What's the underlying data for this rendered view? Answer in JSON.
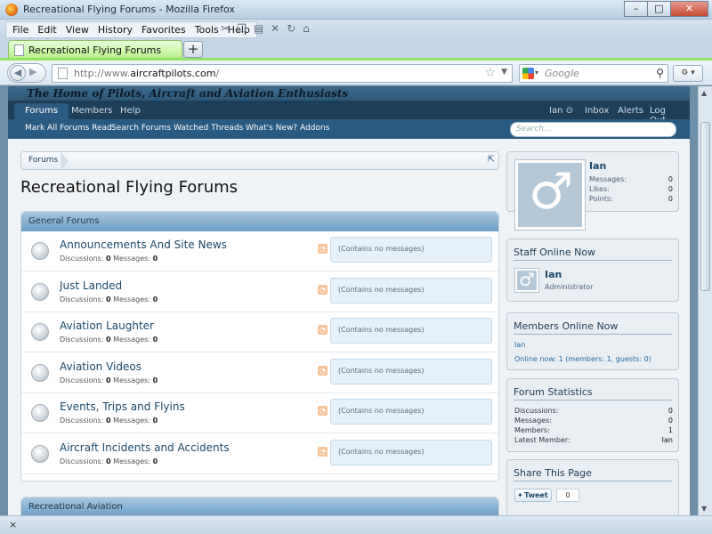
{
  "window": {
    "title": "Recreational Flying Forums - Mozilla Firefox",
    "minimize": "–",
    "maximize": "□",
    "close": "✕"
  },
  "menu": [
    "File",
    "Edit",
    "View",
    "History",
    "Favorites",
    "Tools",
    "Help"
  ],
  "tab": {
    "label": "Recreational Flying Forums",
    "new_tab": "+"
  },
  "address": {
    "prefix": "http://www.",
    "domain": "aircraftpilots.com",
    "suffix": "/"
  },
  "search": {
    "placeholder": "Google"
  },
  "site": {
    "tagline": "The Home of Pilots, Aircraft and Aviation Enthusiasts",
    "tabs": {
      "forums": "Forums",
      "members": "Members",
      "help": "Help"
    },
    "user": {
      "name": "Ian",
      "inbox": "Inbox",
      "alerts": "Alerts",
      "logout": "Log Out"
    },
    "subnav": [
      "Mark All Forums Read",
      "Search Forums",
      "Watched Threads",
      "What's New?",
      "Addons"
    ],
    "search_placeholder": "Search..."
  },
  "breadcrumb": "Forums",
  "page_title": "Recreational Flying Forums",
  "categories": [
    {
      "name": "General Forums",
      "forums": [
        {
          "title": "Announcements And Site News",
          "discussions": "0",
          "messages": "0",
          "last": "(Contains no messages)"
        },
        {
          "title": "Just Landed",
          "discussions": "0",
          "messages": "0",
          "last": "(Contains no messages)"
        },
        {
          "title": "Aviation Laughter",
          "discussions": "0",
          "messages": "0",
          "last": "(Contains no messages)"
        },
        {
          "title": "Aviation Videos",
          "discussions": "0",
          "messages": "0",
          "last": "(Contains no messages)"
        },
        {
          "title": "Events, Trips and Flyins",
          "discussions": "0",
          "messages": "0",
          "last": "(Contains no messages)"
        },
        {
          "title": "Aircraft Incidents and Accidents",
          "discussions": "0",
          "messages": "0",
          "last": "(Contains no messages)"
        }
      ]
    },
    {
      "name": "Recreational Aviation"
    }
  ],
  "labels": {
    "discussions": "Discussions:",
    "messages": "Messages:"
  },
  "sidebar": {
    "visitor": {
      "name": "Ian",
      "rows": [
        {
          "label": "Messages:",
          "value": "0"
        },
        {
          "label": "Likes:",
          "value": "0"
        },
        {
          "label": "Points:",
          "value": "0"
        }
      ]
    },
    "staff": {
      "heading": "Staff Online Now",
      "name": "Ian",
      "role": "Administrator"
    },
    "members": {
      "heading": "Members Online Now",
      "list": "Ian",
      "summary": "Online now: 1 (members: 1, guests: 0)"
    },
    "stats": {
      "heading": "Forum Statistics",
      "rows": [
        {
          "label": "Discussions:",
          "value": "0"
        },
        {
          "label": "Messages:",
          "value": "0"
        },
        {
          "label": "Members:",
          "value": "1"
        },
        {
          "label": "Latest Member:",
          "value": "Ian"
        }
      ]
    },
    "share": {
      "heading": "Share This Page",
      "tweet": "Tweet",
      "count": "0"
    }
  },
  "status": {
    "close": "×"
  },
  "colors": {
    "accent": "#2b5a80",
    "tab_green": "#93e463"
  }
}
